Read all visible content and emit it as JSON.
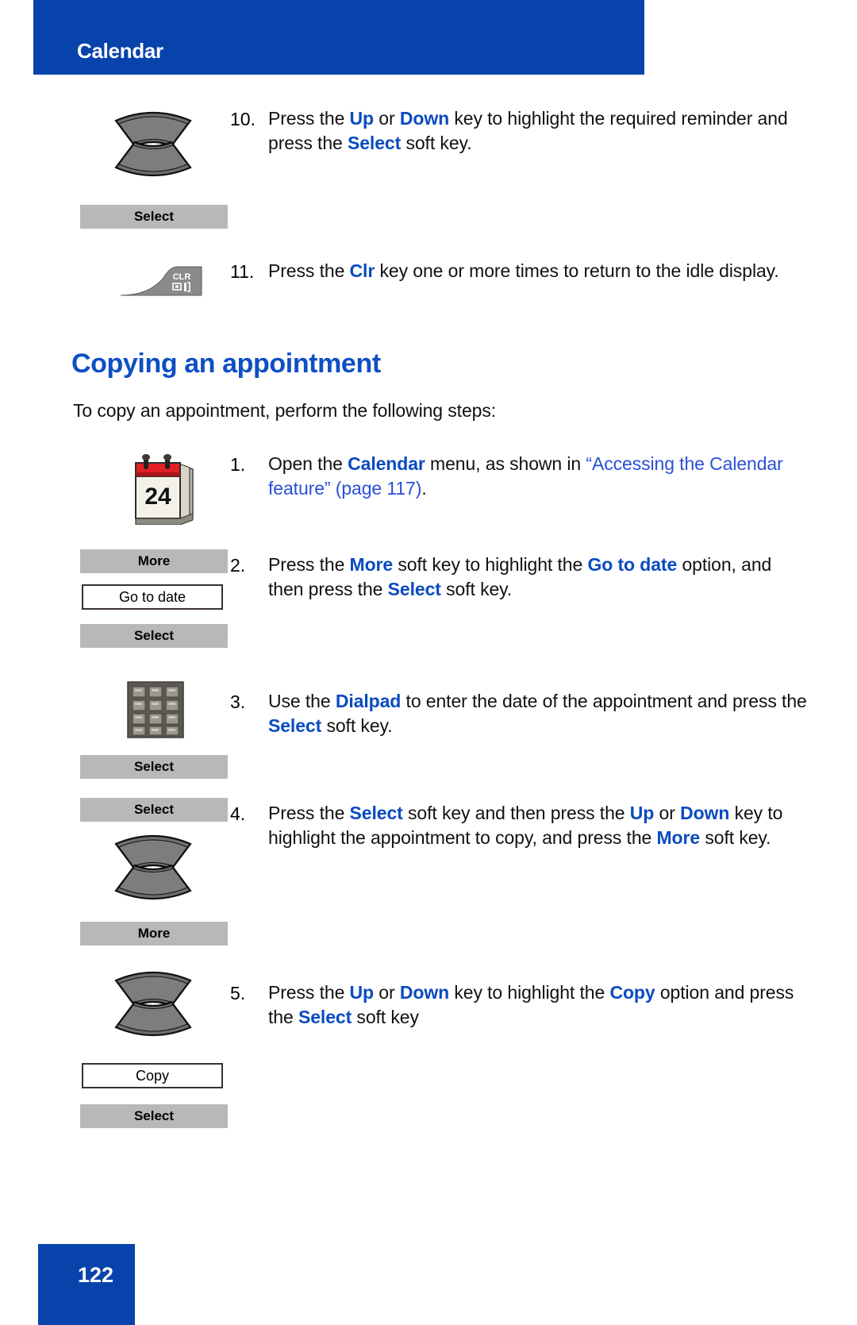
{
  "header": {
    "title": "Calendar",
    "banner_color": "#0843ab"
  },
  "footer": {
    "page_number": "122",
    "banner_color": "#0843ab"
  },
  "colors": {
    "brand_blue": "#0843ab",
    "heading_blue": "#0d4fc4",
    "bold_term_blue": "#0a4bc0",
    "link_blue": "#2a4fd8",
    "softkey_gray": "#b8b8b8"
  },
  "steps_top": [
    {
      "number": "10.",
      "icon": "navigation-up-down-keys",
      "softkey": "Select",
      "text_runs": [
        {
          "t": "Press the ",
          "s": "plain"
        },
        {
          "t": "Up",
          "s": "bold-blue"
        },
        {
          "t": " or ",
          "s": "plain"
        },
        {
          "t": "Down",
          "s": "bold-blue"
        },
        {
          "t": " key to highlight the required reminder and press the ",
          "s": "plain"
        },
        {
          "t": "Select",
          "s": "bold-blue"
        },
        {
          "t": " soft key.",
          "s": "plain"
        }
      ]
    },
    {
      "number": "11.",
      "icon": "clr-key",
      "icon_label": "CLR",
      "text_runs": [
        {
          "t": "Press the ",
          "s": "plain"
        },
        {
          "t": "Clr",
          "s": "bold-blue"
        },
        {
          "t": " key one or more times to return to the idle display.",
          "s": "plain"
        }
      ]
    }
  ],
  "section": {
    "heading": "Copying an appointment",
    "intro": "To copy an appointment, perform the following steps:"
  },
  "steps": [
    {
      "number": "1.",
      "icon": "calendar-icon",
      "icon_day": "24",
      "text_runs": [
        {
          "t": "Open the ",
          "s": "plain"
        },
        {
          "t": "Calendar",
          "s": "bold-blue"
        },
        {
          "t": " menu, as shown in ",
          "s": "plain"
        },
        {
          "t": "“Accessing the Calendar feature” (page 117)",
          "s": "link"
        },
        {
          "t": ".",
          "s": "plain"
        }
      ]
    },
    {
      "number": "2.",
      "icon": "softkey-stack",
      "buttons": [
        {
          "label": "More",
          "type": "softkey"
        },
        {
          "label": "Go to date",
          "type": "option"
        },
        {
          "label": "Select",
          "type": "softkey"
        }
      ],
      "text_runs": [
        {
          "t": "Press the ",
          "s": "plain"
        },
        {
          "t": "More",
          "s": "bold-blue"
        },
        {
          "t": " soft key to highlight the ",
          "s": "plain"
        },
        {
          "t": "Go to date",
          "s": "bold-blue"
        },
        {
          "t": " option, and then press the ",
          "s": "plain"
        },
        {
          "t": "Select",
          "s": "bold-blue"
        },
        {
          "t": " soft key.",
          "s": "plain"
        }
      ]
    },
    {
      "number": "3.",
      "icon": "dialpad-icon",
      "buttons": [
        {
          "label": "Select",
          "type": "softkey"
        }
      ],
      "text_runs": [
        {
          "t": "Use the ",
          "s": "plain"
        },
        {
          "t": "Dialpad",
          "s": "bold-blue"
        },
        {
          "t": " to enter the date of the appointment and press the ",
          "s": "plain"
        },
        {
          "t": "Select",
          "s": "bold-blue"
        },
        {
          "t": " soft key.",
          "s": "plain"
        }
      ]
    },
    {
      "number": "4.",
      "icon": "navigation-up-down-keys",
      "buttons": [
        {
          "label": "Select",
          "type": "softkey"
        },
        {
          "label": "More",
          "type": "softkey"
        }
      ],
      "text_runs": [
        {
          "t": "Press the ",
          "s": "plain"
        },
        {
          "t": "Select",
          "s": "bold-blue"
        },
        {
          "t": " soft key and then press the ",
          "s": "plain"
        },
        {
          "t": "Up",
          "s": "bold-blue"
        },
        {
          "t": " or ",
          "s": "plain"
        },
        {
          "t": "Down",
          "s": "bold-blue"
        },
        {
          "t": " key to highlight the appointment to copy, and press the ",
          "s": "plain"
        },
        {
          "t": "More",
          "s": "bold-blue"
        },
        {
          "t": " soft key.",
          "s": "plain"
        }
      ]
    },
    {
      "number": "5.",
      "icon": "navigation-up-down-keys",
      "buttons": [
        {
          "label": "Copy",
          "type": "option"
        },
        {
          "label": "Select",
          "type": "softkey"
        }
      ],
      "text_runs": [
        {
          "t": "Press the ",
          "s": "plain"
        },
        {
          "t": "Up",
          "s": "bold-blue"
        },
        {
          "t": " or ",
          "s": "plain"
        },
        {
          "t": "Down",
          "s": "bold-blue"
        },
        {
          "t": " key to highlight the ",
          "s": "plain"
        },
        {
          "t": "Copy",
          "s": "bold-blue"
        },
        {
          "t": " option and press the ",
          "s": "plain"
        },
        {
          "t": "Select",
          "s": "bold-blue"
        },
        {
          "t": " soft key",
          "s": "plain"
        }
      ]
    }
  ],
  "step_labels": {
    "step10_num": "10.",
    "step11_num": "11.",
    "step1_num": "1.",
    "step2_num": "2.",
    "step3_num": "3.",
    "step4_num": "4.",
    "step5_num": "5."
  },
  "softkey_labels": {
    "select": "Select",
    "more": "More",
    "go_to_date": "Go to date",
    "copy": "Copy"
  }
}
